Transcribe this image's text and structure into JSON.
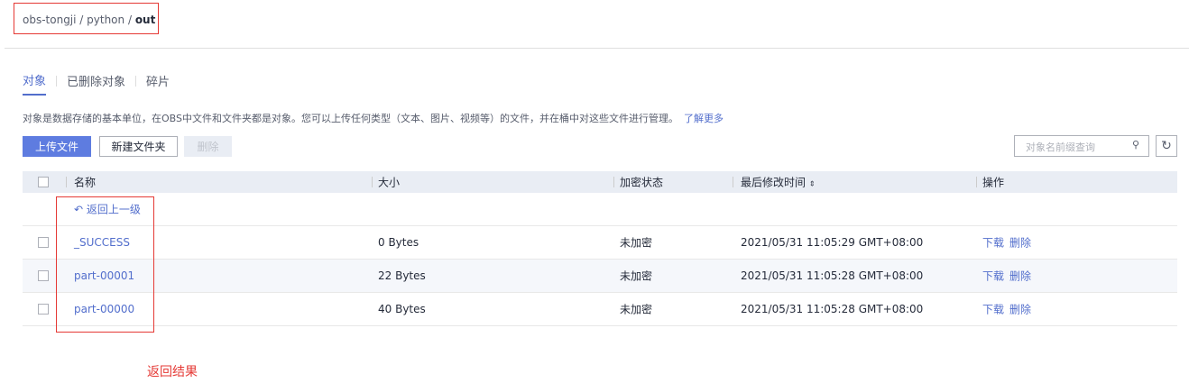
{
  "breadcrumb": {
    "items": [
      "obs-tongji",
      "python"
    ],
    "current": "out"
  },
  "tabs": [
    "对象",
    "已删除对象",
    "碎片"
  ],
  "description": "对象是数据存储的基本单位，在OBS中文件和文件夹都是对象。您可以上传任何类型（文本、图片、视频等）的文件，并在桶中对这些文件进行管理。",
  "learn_more": "了解更多",
  "toolbar": {
    "upload": "上传文件",
    "new_folder": "新建文件夹",
    "delete": "删除",
    "search_placeholder": "对象名前缀查询"
  },
  "table": {
    "headers": [
      "名称",
      "大小",
      "加密状态",
      "最后修改时间",
      "操作"
    ],
    "back": "返回上一级",
    "rows": [
      {
        "name": "_SUCCESS",
        "size": "0 Bytes",
        "enc": "未加密",
        "time": "2021/05/31 11:05:29 GMT+08:00"
      },
      {
        "name": "part-00001",
        "size": "22 Bytes",
        "enc": "未加密",
        "time": "2021/05/31 11:05:28 GMT+08:00"
      },
      {
        "name": "part-00000",
        "size": "40 Bytes",
        "enc": "未加密",
        "time": "2021/05/31 11:05:28 GMT+08:00"
      }
    ],
    "actions": {
      "download": "下载",
      "delete": "删除"
    }
  },
  "annotation": "返回结果"
}
